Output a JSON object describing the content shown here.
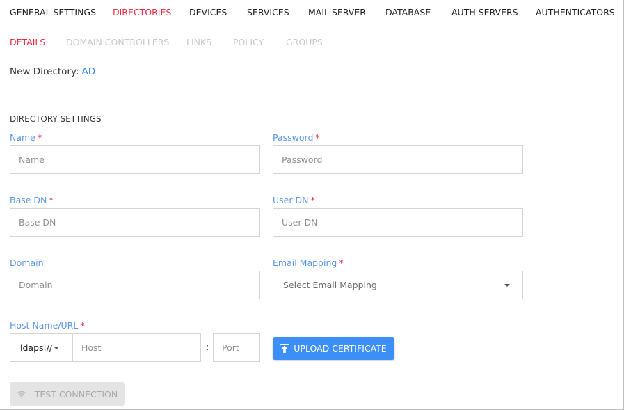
{
  "top_tabs": [
    {
      "label": "GENERAL SETTINGS",
      "active": false
    },
    {
      "label": "DIRECTORIES",
      "active": true
    },
    {
      "label": "DEVICES",
      "active": false
    },
    {
      "label": "SERVICES",
      "active": false
    },
    {
      "label": "MAIL SERVER",
      "active": false
    },
    {
      "label": "DATABASE",
      "active": false
    },
    {
      "label": "AUTH SERVERS",
      "active": false
    },
    {
      "label": "AUTHENTICATORS",
      "active": false
    }
  ],
  "sub_tabs": [
    {
      "label": "DETAILS",
      "active": true
    },
    {
      "label": "DOMAIN CONTROLLERS",
      "active": false
    },
    {
      "label": "LINKS",
      "active": false
    },
    {
      "label": "POLICY",
      "active": false
    },
    {
      "label": "GROUPS",
      "active": false
    }
  ],
  "header": {
    "new_directory_label": "New Directory:",
    "new_directory_value": "AD"
  },
  "section": {
    "title": "DIRECTORY SETTINGS"
  },
  "fields": {
    "name": {
      "label": "Name",
      "required": "*",
      "placeholder": "Name",
      "value": ""
    },
    "password": {
      "label": "Password",
      "required": "*",
      "placeholder": "Password",
      "value": ""
    },
    "base_dn": {
      "label": "Base DN",
      "required": "*",
      "placeholder": "Base DN",
      "value": ""
    },
    "user_dn": {
      "label": "User DN",
      "required": "*",
      "placeholder": "User DN",
      "value": ""
    },
    "domain": {
      "label": "Domain",
      "placeholder": "Domain",
      "value": ""
    },
    "email_mapping": {
      "label": "Email Mapping",
      "required": "*",
      "selected": "Select Email Mapping"
    },
    "host": {
      "label": "Host Name/URL",
      "required": "*",
      "protocol": "ldaps://",
      "host_placeholder": "Host",
      "separator": ":",
      "port_placeholder": "Port"
    }
  },
  "buttons": {
    "upload_certificate": "UPLOAD CERTIFICATE",
    "test_connection": "TEST CONNECTION"
  },
  "colors": {
    "active_tab": "#e8293f",
    "label_blue": "#5b97e6",
    "primary_button": "#3b8ff6",
    "disabled_button": "#e4e4e4"
  },
  "icons": {
    "upload": "upload-icon",
    "wifi": "wifi-icon",
    "caret": "caret-down-icon"
  }
}
